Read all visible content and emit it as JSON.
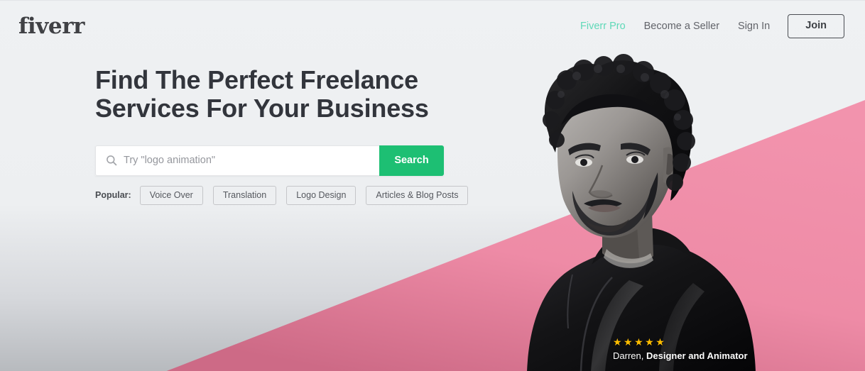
{
  "brand": {
    "logo_text": "fiverr",
    "green": "#1dbf73",
    "pro_teal": "#5fd9b8",
    "pink": "#f08fab",
    "star_gold": "#ffbe00",
    "heading_color": "#32353c"
  },
  "header": {
    "nav": [
      {
        "label": "Fiverr Pro",
        "name": "nav-link-fiverr-pro"
      },
      {
        "label": "Become a Seller",
        "name": "nav-link-become-a-seller"
      },
      {
        "label": "Sign In",
        "name": "nav-link-sign-in"
      }
    ],
    "join_label": "Join"
  },
  "hero": {
    "headline": "Find The Perfect Freelance\nServices For Your Business",
    "search": {
      "placeholder": "Try \"logo animation\"",
      "value": "",
      "button_label": "Search",
      "icon": "search-icon"
    },
    "popular": {
      "label": "Popular:",
      "tags": [
        "Voice Over",
        "Translation",
        "Logo Design",
        "Articles & Blog Posts"
      ]
    }
  },
  "caption": {
    "stars": "★★★★★",
    "rating_count": 5,
    "name": "Darren,",
    "role": "Designer and Animator"
  }
}
